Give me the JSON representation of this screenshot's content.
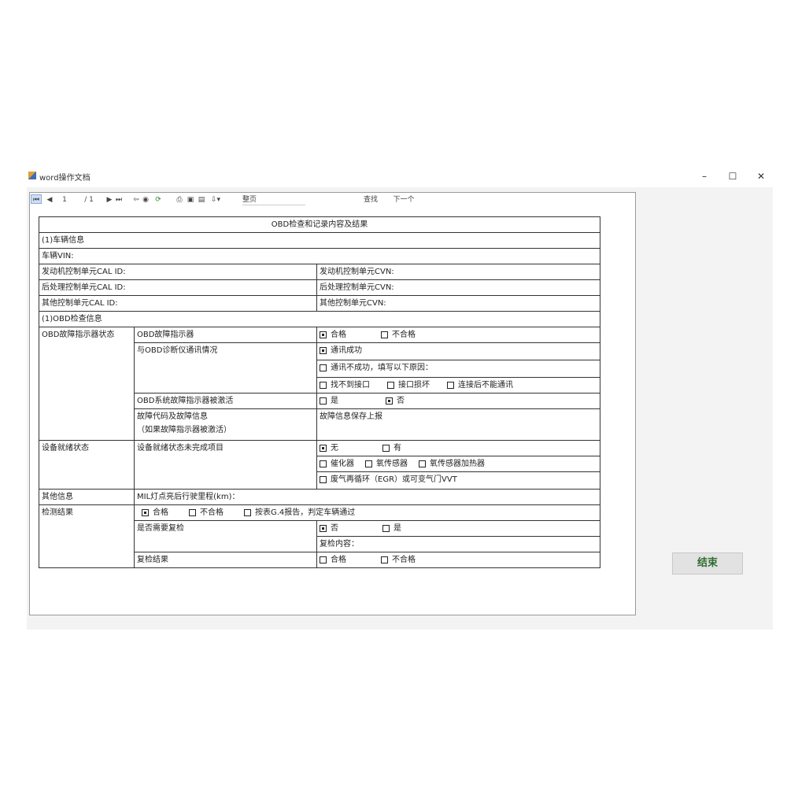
{
  "window": {
    "title": "word操作文档",
    "minimize": "–",
    "maximize": "☐",
    "close": "✕"
  },
  "toolbar": {
    "first": "⏮",
    "prev": "◀",
    "page_value": "1",
    "page_total": "/ 1",
    "next": "▶",
    "last": "⏭",
    "back": "⇦",
    "stop": "◉",
    "refresh": "⟳",
    "print": "⎙",
    "layout": "▣",
    "setup": "▤",
    "export": "⇩▾",
    "zoom": "整页",
    "find_label": "查找",
    "find_next": "下一个"
  },
  "sheet": {
    "title": "OBD检查和记录内容及结果",
    "sec1": "(1)车辆信息",
    "vin": "车辆VIN:",
    "engine_calid": "发动机控制单元CAL ID:",
    "engine_cvn": "发动机控制单元CVN:",
    "after_calid": "后处理控制单元CAL ID:",
    "after_cvn": "后处理控制单元CVN:",
    "other_calid": "其他控制单元CAL ID:",
    "other_cvn": "其他控制单元CVN:",
    "sec2": "(1)OBD检查信息",
    "obd_status": "OBD故障指示器状态",
    "mil_label": "OBD故障指示器",
    "mil_pass": "合格",
    "mil_fail": "不合格",
    "comm_label": "与OBD诊断仪通讯情况",
    "comm_ok": "通讯成功",
    "comm_fail": "通讯不成功，填写以下原因：",
    "reason1": "找不到接口",
    "reason2": "接口损坏",
    "reason3": "连接后不能通讯",
    "activated_label": "OBD系统故障指示器被激活",
    "act_yes": "是",
    "act_no": "否",
    "dtc_label1": "故障代码及故障信息",
    "dtc_label2": "（如果故障指示器被激活）",
    "dtc_value": "故障信息保存上报",
    "readiness": "设备就绪状态",
    "readiness_label": "设备就绪状态未完成项目",
    "rd_none": "无",
    "rd_has": "有",
    "rd_cat": "催化器",
    "rd_o2": "氧传感器",
    "rd_o2h": "氧传感器加热器",
    "rd_egr": "废气再循环（EGR）或可变气门VVT",
    "other_info": "其他信息",
    "mil_distance": "MIL灯点亮后行驶里程(km)：",
    "result": "检测结果",
    "res_pass": "合格",
    "res_fail": "不合格",
    "res_pass2": "按表G.4报告，判定车辆通过",
    "recheck_label": "是否需要复检",
    "recheck_no": "否",
    "recheck_yes": "是",
    "recheck_content": "复检内容：",
    "recheck_result": "复检结果",
    "rr_pass": "合格",
    "rr_fail": "不合格"
  },
  "end_button": "结束"
}
